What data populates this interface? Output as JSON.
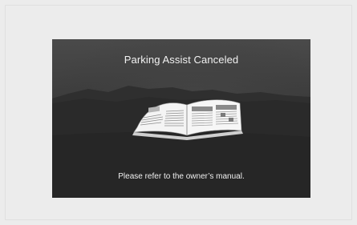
{
  "screen": {
    "title": "Parking Assist Canceled",
    "message": "Please refer to the owner’s manual.",
    "icon": "owners-manual-book-icon"
  },
  "colors": {
    "page_background": "#ececec",
    "screen_background": "#3c3c3c",
    "text": "#f2f2f2"
  }
}
